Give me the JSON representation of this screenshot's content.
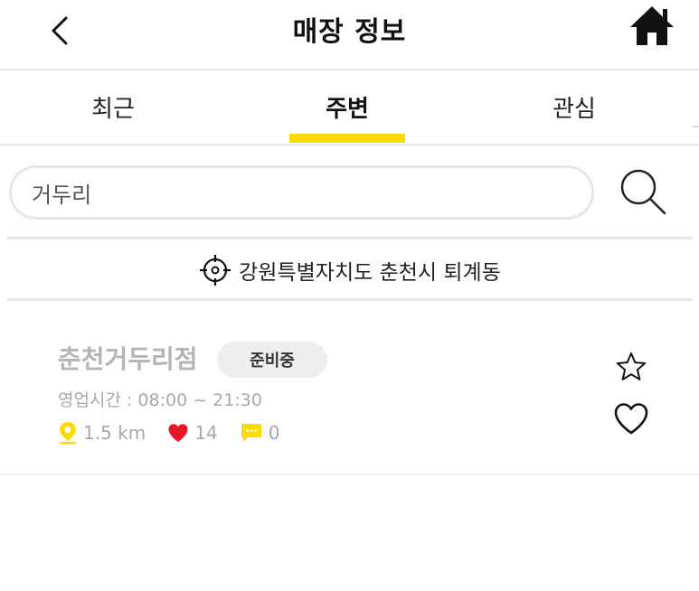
{
  "header": {
    "title": "매장 정보",
    "back_icon": "chevron-left-icon",
    "home_icon": "home-icon"
  },
  "tabs": [
    {
      "label": "최근",
      "active": false
    },
    {
      "label": "주변",
      "active": true
    },
    {
      "label": "관심",
      "active": false
    }
  ],
  "search": {
    "value": "거두리",
    "icon": "search-icon"
  },
  "location": {
    "icon": "crosshair-icon",
    "text": "강원특별자치도 춘천시 퇴계동"
  },
  "stores": [
    {
      "name": "춘천거두리점",
      "status": "준비중",
      "hours": "영업시간 : 08:00 ~ 21:30",
      "distance": "1.5 km",
      "likes": "14",
      "comments": "0",
      "favorite": false,
      "liked": false
    }
  ],
  "colors": {
    "accent": "#fddb00",
    "heart": "#e8152b",
    "muted_text": "#a8a8a8"
  }
}
